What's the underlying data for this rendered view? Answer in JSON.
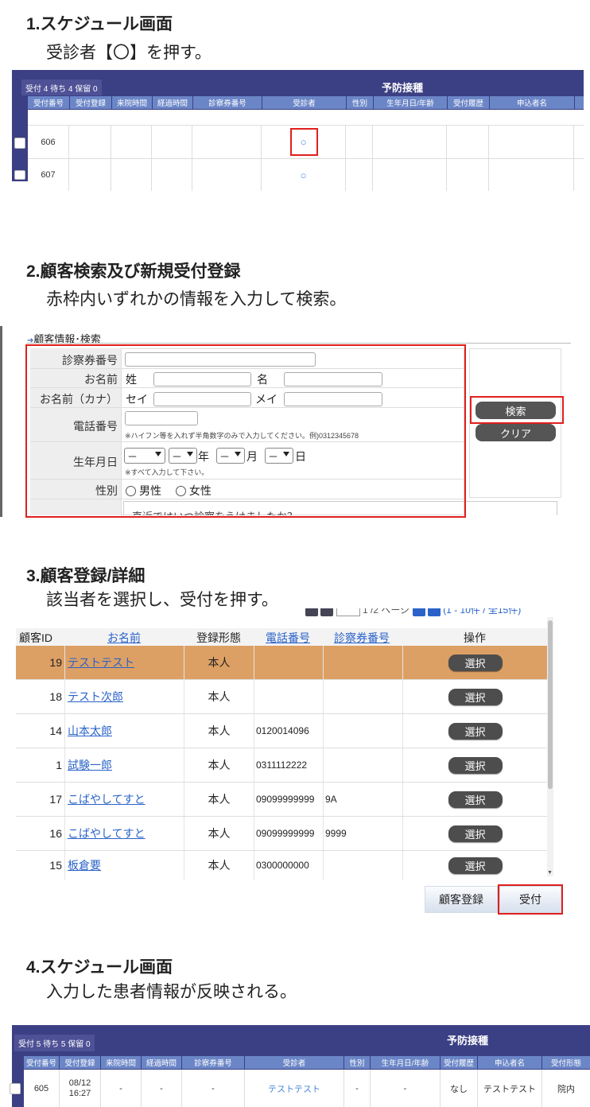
{
  "steps": [
    {
      "heading": "1.スケジュール画面",
      "desc": "受診者【〇】を押す。"
    },
    {
      "heading": "2.顧客検索及び新規受付登録",
      "desc": "赤枠内いずれかの情報を入力して検索。"
    },
    {
      "heading": "3.顧客登録/詳細",
      "desc": "該当者を選択し、受付を押す。"
    },
    {
      "heading": "4.スケジュール画面",
      "desc": "入力した患者情報が反映される。"
    }
  ],
  "schedule1": {
    "counter": "受付 4  待ち 4  保留 0",
    "title": "予防接種",
    "columns": [
      "受付番号",
      "受付登録",
      "来院時間",
      "経過時間",
      "診察券番号",
      "受診者",
      "性別",
      "生年月日/年齢",
      "受付履歴",
      "申込者名"
    ],
    "rows": [
      {
        "number": "606",
        "patient": "○"
      },
      {
        "number": "607",
        "patient": "○"
      }
    ]
  },
  "search_form": {
    "section_title": "顧客情報･検索",
    "labels": {
      "card_number": "診察券番号",
      "name": "お名前",
      "name_kana": "お名前（カナ）",
      "phone": "電話番号",
      "birthday": "生年月日",
      "gender": "性別"
    },
    "sei": "姓",
    "mei": "名",
    "sei_kana": "セイ",
    "mei_kana": "メイ",
    "phone_note": "※ハイフン等を入れず半角数字のみで入力してください。例)0312345678",
    "birthday_note": "※すべて入力して下さい。",
    "select_value": "－",
    "year": "年",
    "month": "月",
    "day": "日",
    "male": "男性",
    "female": "女性",
    "visit_question": "直近ではいつ診察をうけましたか？",
    "search_button": "検索",
    "clear_button": "クリア"
  },
  "customer_list": {
    "pager_text": "1 /2 ページ",
    "range_text": "(1 - 10件 / 全15件)",
    "columns": [
      "顧客ID",
      "お名前",
      "登録形態",
      "電話番号",
      "診察券番号",
      "操作"
    ],
    "rows": [
      {
        "id": "19",
        "name": "テストテスト",
        "type": "本人",
        "phone": "",
        "card": "",
        "action": "選択",
        "highlight": true
      },
      {
        "id": "18",
        "name": "テスト次郎",
        "type": "本人",
        "phone": "",
        "card": "",
        "action": "選択"
      },
      {
        "id": "14",
        "name": "山本太郎",
        "type": "本人",
        "phone": "0120014096",
        "card": "",
        "action": "選択"
      },
      {
        "id": "1",
        "name": "試験一郎",
        "type": "本人",
        "phone": "0311112222",
        "card": "",
        "action": "選択"
      },
      {
        "id": "17",
        "name": "こばやしてすと",
        "type": "本人",
        "phone": "09099999999",
        "card": "9A",
        "action": "選択"
      },
      {
        "id": "16",
        "name": "こばやしてすと",
        "type": "本人",
        "phone": "09099999999",
        "card": "9999",
        "action": "選択"
      },
      {
        "id": "15",
        "name": "板倉要",
        "type": "本人",
        "phone": "0300000000",
        "card": "",
        "action": "選択"
      }
    ],
    "register_button": "顧客登録",
    "reception_button": "受付"
  },
  "schedule2": {
    "counter": "受付 5  待ち 5  保留 0",
    "title": "予防接種",
    "columns": [
      "受付番号",
      "受付登録",
      "来院時間",
      "経過時間",
      "診察券番号",
      "受診者",
      "性別",
      "生年月日/年齢",
      "受付履歴",
      "申込者名",
      "受付形態"
    ],
    "row": {
      "number": "605",
      "date": "08/12",
      "time": "16:27",
      "arrival": "-",
      "elapsed": "-",
      "card": "-",
      "patient": "テストテスト",
      "gender": "-",
      "birthday": "-",
      "history": "なし",
      "applicant": "テストテスト",
      "form": "院内"
    }
  },
  "colors": {
    "navy": "#3b3f83",
    "header_cell": "#6b86c7",
    "highlight_row": "#dda064",
    "red_frame": "#e0201c",
    "link": "#2a62c9"
  }
}
